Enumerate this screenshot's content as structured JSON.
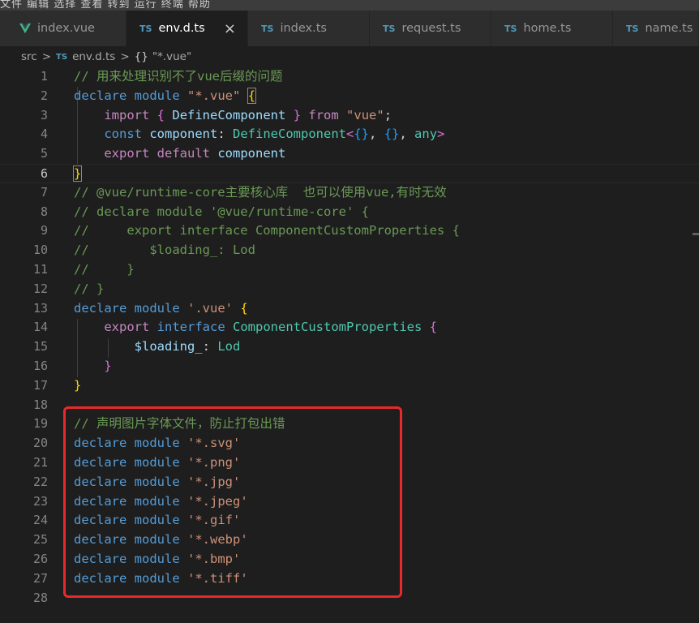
{
  "menubar": {
    "text": "文件 编辑 选择 查看 转到 运行 终端 帮助"
  },
  "tabs": [
    {
      "icon": "vue-icon",
      "label": "index.vue",
      "active": false
    },
    {
      "icon": "ts-icon",
      "badge": "TS",
      "label": "env.d.ts",
      "active": true,
      "close": "×"
    },
    {
      "icon": "ts-icon",
      "badge": "TS",
      "label": "index.ts",
      "active": false
    },
    {
      "icon": "ts-icon",
      "badge": "TS",
      "label": "request.ts",
      "active": false
    },
    {
      "icon": "ts-icon",
      "badge": "TS",
      "label": "home.ts",
      "active": false
    },
    {
      "icon": "ts-icon",
      "badge": "TS",
      "label": "name.ts",
      "active": false
    }
  ],
  "breadcrumb": {
    "folder": "src",
    "badge": "TS",
    "file": "env.d.ts",
    "braces": "{}",
    "symbol": "\"*.vue\"",
    "separator": ">"
  },
  "editor": {
    "current_line": 6,
    "line_numbers": [
      "1",
      "2",
      "3",
      "4",
      "5",
      "6",
      "7",
      "8",
      "9",
      "10",
      "11",
      "12",
      "13",
      "14",
      "15",
      "16",
      "17",
      "18",
      "19",
      "20",
      "21",
      "22",
      "23",
      "24",
      "25",
      "26",
      "27",
      "28"
    ],
    "lines": [
      [
        [
          "cm",
          "// 用来处理识别不了vue后缀的问题"
        ]
      ],
      [
        [
          "kw",
          "declare"
        ],
        [
          "",
          " "
        ],
        [
          "kw",
          "module"
        ],
        [
          "",
          " "
        ],
        [
          "st",
          "\"*.vue\""
        ],
        [
          "",
          " "
        ],
        [
          "br1",
          "{"
        ]
      ],
      [
        [
          "",
          "    "
        ],
        [
          "ctl",
          "import"
        ],
        [
          "",
          " "
        ],
        [
          "br2",
          "{"
        ],
        [
          "",
          " "
        ],
        [
          "vr",
          "DefineComponent"
        ],
        [
          "",
          " "
        ],
        [
          "br2",
          "}"
        ],
        [
          "",
          " "
        ],
        [
          "ctl",
          "from"
        ],
        [
          "",
          " "
        ],
        [
          "st",
          "\"vue\""
        ],
        [
          "",
          ";"
        ]
      ],
      [
        [
          "",
          "    "
        ],
        [
          "kw",
          "const"
        ],
        [
          "",
          " "
        ],
        [
          "vr",
          "component"
        ],
        [
          "",
          ": "
        ],
        [
          "ty",
          "DefineComponent"
        ],
        [
          "br2",
          "<"
        ],
        [
          "br3",
          "{}"
        ],
        [
          "",
          ", "
        ],
        [
          "br3",
          "{}"
        ],
        [
          "",
          ", "
        ],
        [
          "ty",
          "any"
        ],
        [
          "br2",
          ">"
        ]
      ],
      [
        [
          "",
          "    "
        ],
        [
          "ctl",
          "export"
        ],
        [
          "",
          " "
        ],
        [
          "ctl",
          "default"
        ],
        [
          "",
          " "
        ],
        [
          "vr",
          "component"
        ]
      ],
      [
        [
          "br1",
          "}"
        ]
      ],
      [
        [
          "cm",
          "// @vue/runtime-core主要核心库  也可以使用vue,有时无效"
        ]
      ],
      [
        [
          "cm",
          "// declare module '@vue/runtime-core' {"
        ]
      ],
      [
        [
          "cm",
          "//     export interface ComponentCustomProperties {"
        ]
      ],
      [
        [
          "cm",
          "//        $loading_: Lod"
        ]
      ],
      [
        [
          "cm",
          "//     }"
        ]
      ],
      [
        [
          "cm",
          "// }"
        ]
      ],
      [
        [
          "kw",
          "declare"
        ],
        [
          "",
          " "
        ],
        [
          "kw",
          "module"
        ],
        [
          "",
          " "
        ],
        [
          "st",
          "'.vue'"
        ],
        [
          "",
          " "
        ],
        [
          "br1",
          "{"
        ]
      ],
      [
        [
          "",
          "    "
        ],
        [
          "ctl",
          "export"
        ],
        [
          "",
          " "
        ],
        [
          "kw",
          "interface"
        ],
        [
          "",
          " "
        ],
        [
          "ty",
          "ComponentCustomProperties"
        ],
        [
          "",
          " "
        ],
        [
          "br2",
          "{"
        ]
      ],
      [
        [
          "",
          "        "
        ],
        [
          "vr",
          "$loading_"
        ],
        [
          "",
          ": "
        ],
        [
          "ty",
          "Lod"
        ]
      ],
      [
        [
          "",
          "    "
        ],
        [
          "br2",
          "}"
        ]
      ],
      [
        [
          "br1",
          "}"
        ]
      ],
      [],
      [
        [
          "cm",
          "// 声明图片字体文件，防止打包出错"
        ]
      ],
      [
        [
          "kw",
          "declare"
        ],
        [
          "",
          " "
        ],
        [
          "kw",
          "module"
        ],
        [
          "",
          " "
        ],
        [
          "st",
          "'*.svg'"
        ]
      ],
      [
        [
          "kw",
          "declare"
        ],
        [
          "",
          " "
        ],
        [
          "kw",
          "module"
        ],
        [
          "",
          " "
        ],
        [
          "st",
          "'*.png'"
        ]
      ],
      [
        [
          "kw",
          "declare"
        ],
        [
          "",
          " "
        ],
        [
          "kw",
          "module"
        ],
        [
          "",
          " "
        ],
        [
          "st",
          "'*.jpg'"
        ]
      ],
      [
        [
          "kw",
          "declare"
        ],
        [
          "",
          " "
        ],
        [
          "kw",
          "module"
        ],
        [
          "",
          " "
        ],
        [
          "st",
          "'*.jpeg'"
        ]
      ],
      [
        [
          "kw",
          "declare"
        ],
        [
          "",
          " "
        ],
        [
          "kw",
          "module"
        ],
        [
          "",
          " "
        ],
        [
          "st",
          "'*.gif'"
        ]
      ],
      [
        [
          "kw",
          "declare"
        ],
        [
          "",
          " "
        ],
        [
          "kw",
          "module"
        ],
        [
          "",
          " "
        ],
        [
          "st",
          "'*.webp'"
        ]
      ],
      [
        [
          "kw",
          "declare"
        ],
        [
          "",
          " "
        ],
        [
          "kw",
          "module"
        ],
        [
          "",
          " "
        ],
        [
          "st",
          "'*.bmp'"
        ]
      ],
      [
        [
          "kw",
          "declare"
        ],
        [
          "",
          " "
        ],
        [
          "kw",
          "module"
        ],
        [
          "",
          " "
        ],
        [
          "st",
          "'*.tiff'"
        ]
      ],
      []
    ]
  },
  "colors": {
    "background": "#1e1e1e",
    "keyword": "#569cd6",
    "control": "#c586c0",
    "type": "#4ec9b0",
    "string": "#ce9178",
    "variable": "#9cdcfe",
    "comment": "#6a9955",
    "highlight_box": "#e8292b"
  }
}
